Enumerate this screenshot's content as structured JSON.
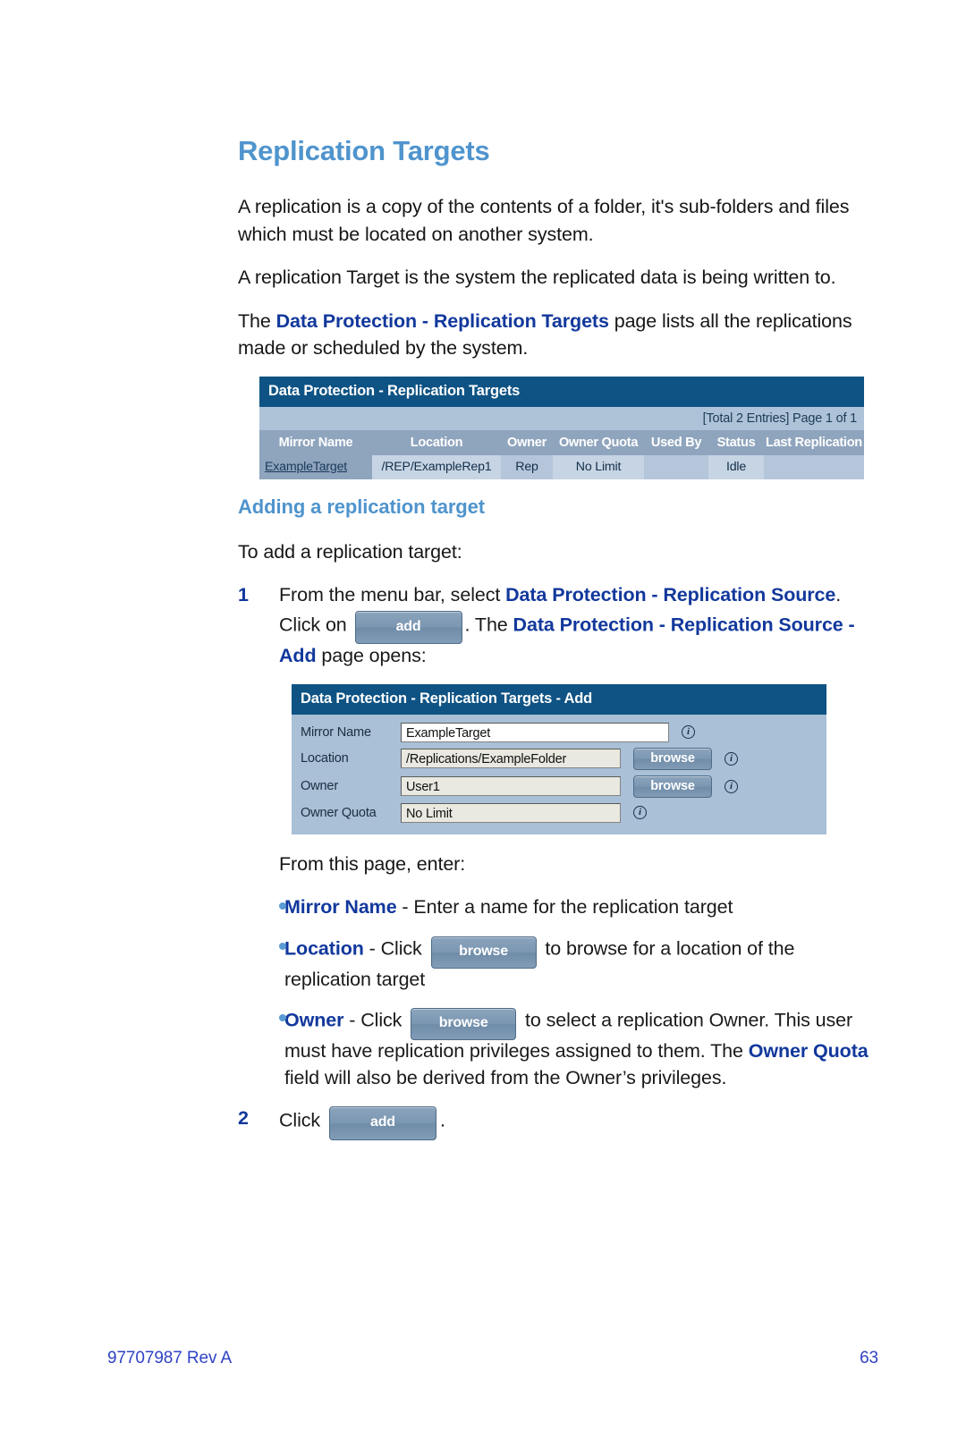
{
  "document": {
    "title": "Replication Targets",
    "paragraphs": [
      "A replication is a copy of the contents of a folder, it's sub-folders and files which must be located on another system.",
      "A replication Target is the system the replicated data is being written to."
    ],
    "para3": {
      "pre": "The ",
      "bold": "Data Protection - Replication Targets",
      "post": " page lists all the replications made or scheduled by the system."
    },
    "subheading": "Adding a replication target",
    "intro_line": "To add a replication target:"
  },
  "list_screenshot": {
    "window_title": "Data Protection - Replication Targets",
    "pagination": "[Total 2 Entries] Page 1 of 1",
    "columns": [
      "Mirror Name",
      "Location",
      "Owner",
      "Owner Quota",
      "Used By",
      "Status",
      "Last Replication Time"
    ],
    "rows": [
      {
        "mirror_name": "ExampleTarget",
        "location": "/REP/ExampleRep1",
        "owner": "Rep",
        "owner_quota": "No Limit",
        "used_by": "",
        "status": "Idle",
        "last_replication_time": ""
      }
    ]
  },
  "steps": [
    {
      "number": "1",
      "text_a": "From the menu bar, select ",
      "bold_a": "Data Protection - Replication Source",
      "text_b": ". Click on ",
      "button": "add",
      "text_c": ". The ",
      "bold_b": "Data Protection - Replication Source - Add",
      "text_d": " page opens:"
    },
    {
      "number": "2",
      "text_a": "Click ",
      "button": "add",
      "text_b": "."
    }
  ],
  "form_screenshot": {
    "window_title": "Data Protection - Replication Targets - Add",
    "fields": [
      {
        "label": "Mirror Name",
        "value": "ExampleTarget",
        "browse_label": "",
        "has_browse": false,
        "info_icon": "info-icon"
      },
      {
        "label": "Location",
        "value": "/Replications/ExampleFolder",
        "browse_label": "browse",
        "has_browse": true,
        "info_icon": "info-icon"
      },
      {
        "label": "Owner",
        "value": "User1",
        "browse_label": "browse",
        "has_browse": true,
        "info_icon": "info-icon"
      },
      {
        "label": "Owner Quota",
        "value": "No Limit",
        "browse_label": "",
        "has_browse": false,
        "info_icon": "info-icon"
      }
    ]
  },
  "enter_intro": "From this page, enter:",
  "bullets": [
    {
      "bold": "Mirror Name",
      "text_a": " - Enter a name for the replication target",
      "button": "",
      "text_b": ""
    },
    {
      "bold": "Location",
      "text_a": " - Click ",
      "button": "browse",
      "text_b": " to browse for a location of the replication target"
    },
    {
      "bold": "Owner",
      "text_a": " - Click ",
      "button": "browse",
      "text_b": " to select a replication Owner. This user must have replication privileges assigned to them. The ",
      "bold2": "Owner Quota",
      "text_c": " field will also be derived from the Owner’s privileges."
    }
  ],
  "footer": {
    "doc_id": "97707987 Rev A",
    "page_number": "63"
  },
  "colors": {
    "heading_blue": "#4f94cd",
    "bold_blue": "#12389c",
    "titlebar_blue": "#0e5384",
    "table_header_blue": "#8fa4bd",
    "pagebar_blue": "#aec3d8",
    "form_bg": "#a9c0d6",
    "footer_blue": "#2f43c4",
    "bullet_blue": "#5a9bd4"
  }
}
